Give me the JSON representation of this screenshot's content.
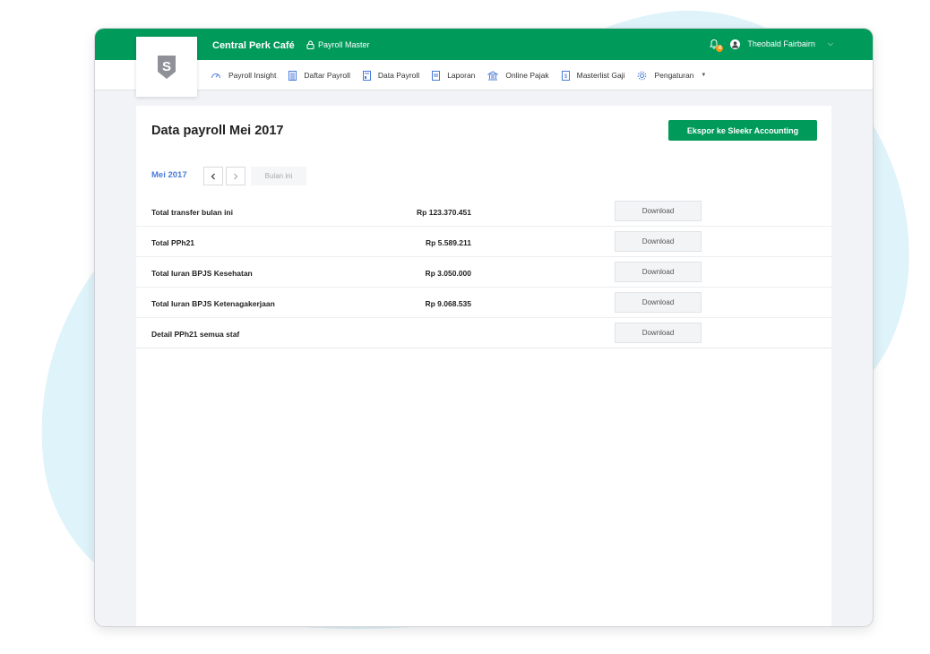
{
  "header": {
    "company": "Central Perk Café",
    "role": "Payroll Master",
    "notification_count": "4",
    "user_name": "Theobald Fairbairn"
  },
  "nav": {
    "items": [
      {
        "label": "Payroll Insight",
        "icon": "gauge-icon"
      },
      {
        "label": "Daftar Payroll",
        "icon": "list-icon"
      },
      {
        "label": "Data Payroll",
        "icon": "document-icon"
      },
      {
        "label": "Laporan",
        "icon": "report-icon"
      },
      {
        "label": "Online Pajak",
        "icon": "bank-icon"
      },
      {
        "label": "Masterlist Gaji",
        "icon": "salary-icon"
      },
      {
        "label": "Pengaturan",
        "icon": "gear-icon"
      }
    ]
  },
  "page": {
    "title": "Data payroll Mei 2017",
    "export_label": "Ekspor ke Sleekr Accounting",
    "month_label": "Mei 2017",
    "this_month_label": "Bulan ini"
  },
  "rows": [
    {
      "label": "Total transfer bulan ini",
      "value": "Rp 123.370.451",
      "action": "Download"
    },
    {
      "label": "Total PPh21",
      "value": "Rp 5.589.211",
      "action": "Download"
    },
    {
      "label": "Total Iuran BPJS Kesehatan",
      "value": "Rp 3.050.000",
      "action": "Download"
    },
    {
      "label": "Total Iuran BPJS Ketenagakerjaan",
      "value": "Rp 9.068.535",
      "action": "Download"
    },
    {
      "label": "Detail PPh21 semua staf",
      "value": "",
      "action": "Download"
    }
  ],
  "colors": {
    "brand_green": "#009a5a",
    "link_blue": "#4a7bd9",
    "background_blob": "#dff3fa"
  }
}
